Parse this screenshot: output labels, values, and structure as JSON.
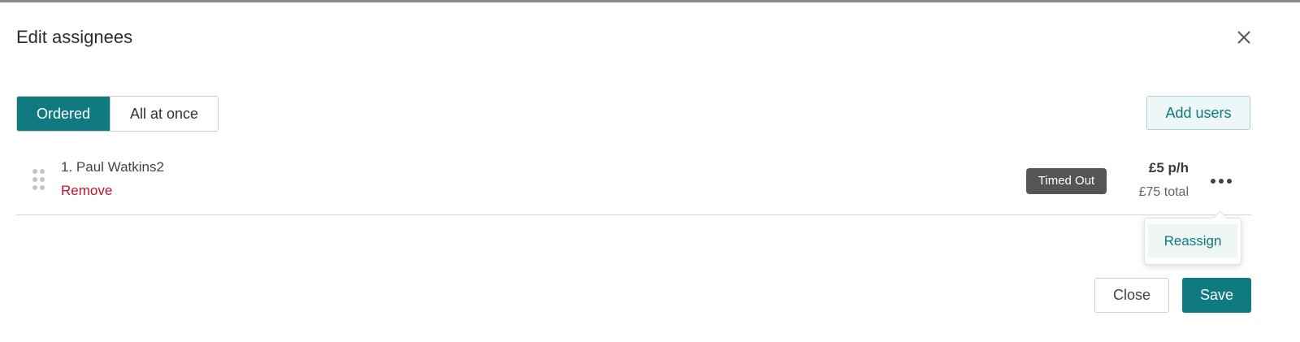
{
  "dialog": {
    "title": "Edit assignees",
    "close_icon": "close-icon"
  },
  "mode_toggle": {
    "options": [
      {
        "label": "Ordered",
        "active": true
      },
      {
        "label": "All at once",
        "active": false
      }
    ]
  },
  "actions": {
    "add_users": "Add users"
  },
  "assignees": [
    {
      "name": "1. Paul Watkins2",
      "remove_label": "Remove",
      "status": "Timed Out",
      "rate": "£5 p/h",
      "total": "£75 total",
      "menu_icon": "more-horizontal-icon"
    }
  ],
  "row_menu": {
    "items": [
      {
        "label": "Reassign"
      }
    ]
  },
  "footer": {
    "close_label": "Close",
    "save_label": "Save"
  },
  "colors": {
    "accent": "#0f7a80",
    "danger": "#c8102e",
    "badge": "#555555"
  }
}
